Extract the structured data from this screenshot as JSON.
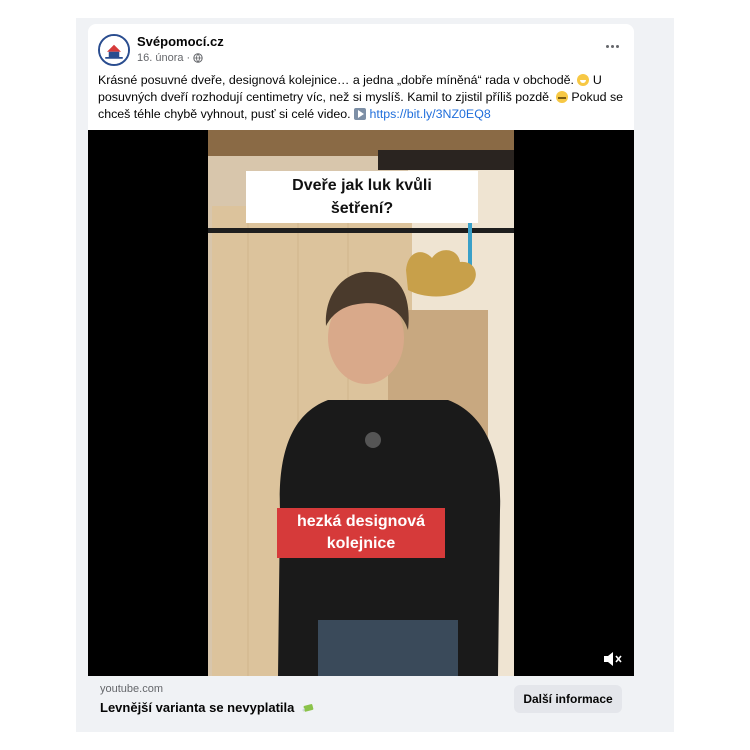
{
  "post": {
    "page_name": "Svépomocí.cz",
    "date": "16. února",
    "separator": "·",
    "text_part1": "Krásné posuvné dveře, designová kolejnice… a jedna „dobře míněná“ rada v obchodě.",
    "text_part2": "U posuvných dveří rozhodují centimetry víc, než si myslíš. Kamil to zjistil příliš pozdě.",
    "text_part3": "Pokud se chceš téhle chybě vyhnout, pusť si celé video.",
    "link": "https://bit.ly/3NZ0EQ8",
    "icons": {
      "avatar": "svepomoci-logo",
      "privacy": "globe-icon",
      "more": "more-options-icon",
      "emoji1": "grinning-face-icon",
      "emoji2": "grimacing-face-icon",
      "emoji3": "play-button-icon"
    }
  },
  "video": {
    "title_line1": "Dveře jak luk kvůli",
    "title_line2": "šetření?",
    "caption_line1": "hezká designová",
    "caption_line2": "kolejnice",
    "mute_icon": "muted-speaker-icon"
  },
  "link_preview": {
    "domain": "youtube.com",
    "title": "Levnější varianta se nevyplatila",
    "title_icon": "money-with-wings-icon",
    "button_label": "Další informace"
  },
  "colors": {
    "link": "#216fdb",
    "caption_bg": "#d63a3a",
    "preview_bg": "#f0f2f5",
    "button_bg": "#e4e6eb"
  }
}
